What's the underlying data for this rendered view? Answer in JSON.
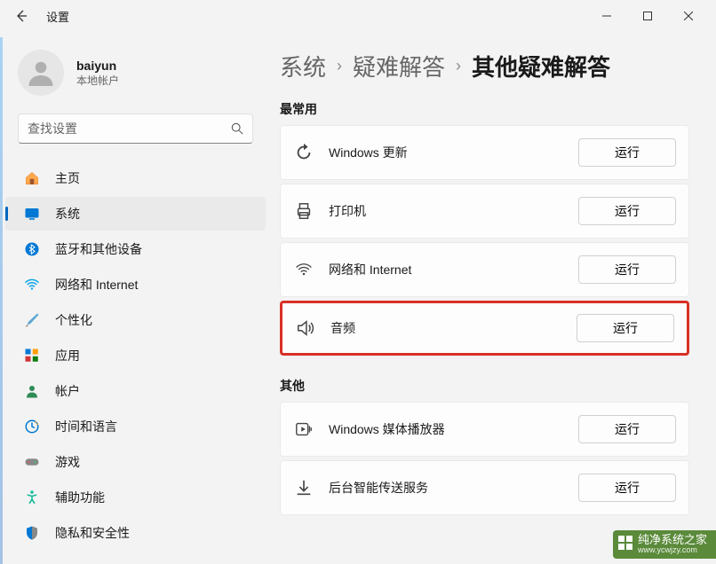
{
  "window": {
    "title": "设置"
  },
  "user": {
    "name": "baiyun",
    "account_type": "本地帐户"
  },
  "search": {
    "placeholder": "查找设置"
  },
  "sidebar": {
    "items": [
      {
        "label": "主页",
        "icon": "home"
      },
      {
        "label": "系统",
        "icon": "system",
        "active": true
      },
      {
        "label": "蓝牙和其他设备",
        "icon": "bluetooth"
      },
      {
        "label": "网络和 Internet",
        "icon": "wifi"
      },
      {
        "label": "个性化",
        "icon": "brush"
      },
      {
        "label": "应用",
        "icon": "apps"
      },
      {
        "label": "帐户",
        "icon": "person"
      },
      {
        "label": "时间和语言",
        "icon": "clock"
      },
      {
        "label": "游戏",
        "icon": "game"
      },
      {
        "label": "辅助功能",
        "icon": "accessibility"
      },
      {
        "label": "隐私和安全性",
        "icon": "shield"
      }
    ]
  },
  "breadcrumb": {
    "c0": "系统",
    "c1": "疑难解答",
    "c2": "其他疑难解答"
  },
  "sections": {
    "frequent": "最常用",
    "other": "其他"
  },
  "troubleshooters": {
    "run_label": "运行",
    "frequent": [
      {
        "label": "Windows 更新",
        "icon": "sync"
      },
      {
        "label": "打印机",
        "icon": "printer"
      },
      {
        "label": "网络和 Internet",
        "icon": "wifi2"
      },
      {
        "label": "音频",
        "icon": "audio",
        "highlight": true
      }
    ],
    "other": [
      {
        "label": "Windows 媒体播放器",
        "icon": "media"
      },
      {
        "label": "后台智能传送服务",
        "icon": "download"
      }
    ]
  },
  "watermark": {
    "name": "纯净系统之家",
    "url": "www.ycwjzy.com"
  }
}
